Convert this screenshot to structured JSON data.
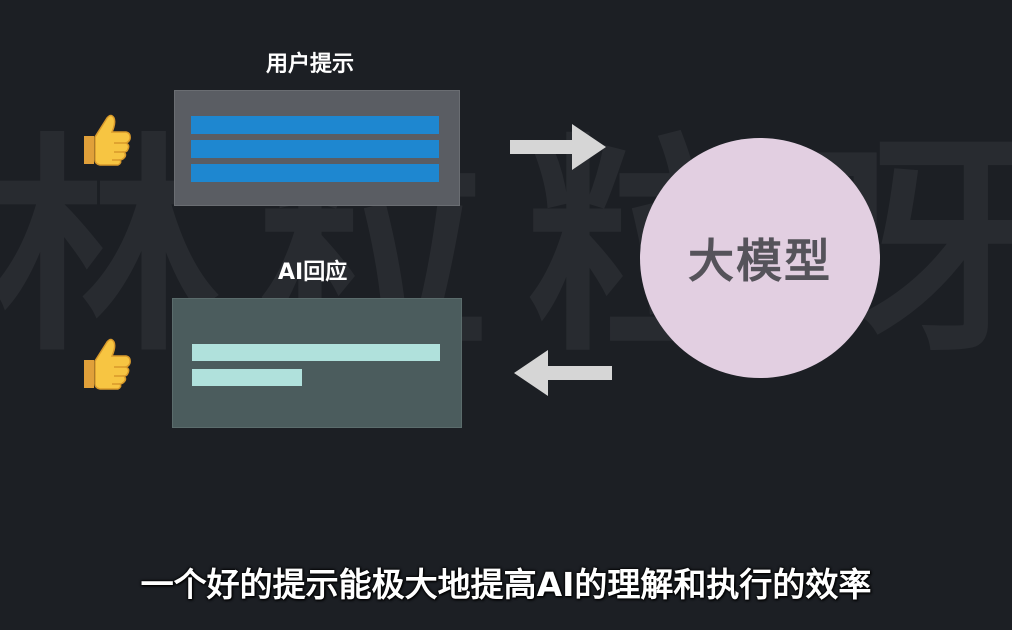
{
  "watermark": {
    "chars": [
      "林",
      "粒",
      "粒",
      "呀"
    ]
  },
  "labels": {
    "user_prompt": "用户提示",
    "ai_response": "AI回应"
  },
  "model": {
    "label": "大模型"
  },
  "caption": "一个好的提示能极大地提高AI的理解和执行的效率",
  "colors": {
    "background": "#1c1f24",
    "prompt_bar": "#1e87d0",
    "response_bar": "#b0e1dc",
    "model_circle": "#e2cfe1",
    "arrow": "#d6d6d6"
  },
  "icons": {
    "feedback": "thumbs-up-icon",
    "flow_in": "arrow-right-icon",
    "flow_out": "arrow-left-icon"
  }
}
